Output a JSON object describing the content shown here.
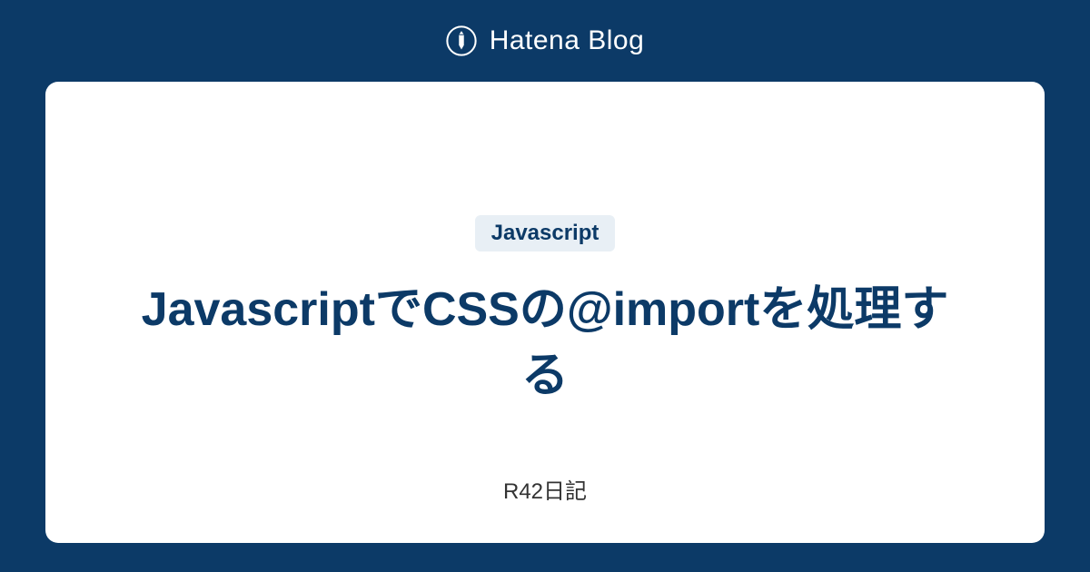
{
  "header": {
    "logo_text": "Hatena Blog"
  },
  "card": {
    "tag": "Javascript",
    "title": "JavascriptでCSSの@importを処理する",
    "author": "R42日記"
  }
}
